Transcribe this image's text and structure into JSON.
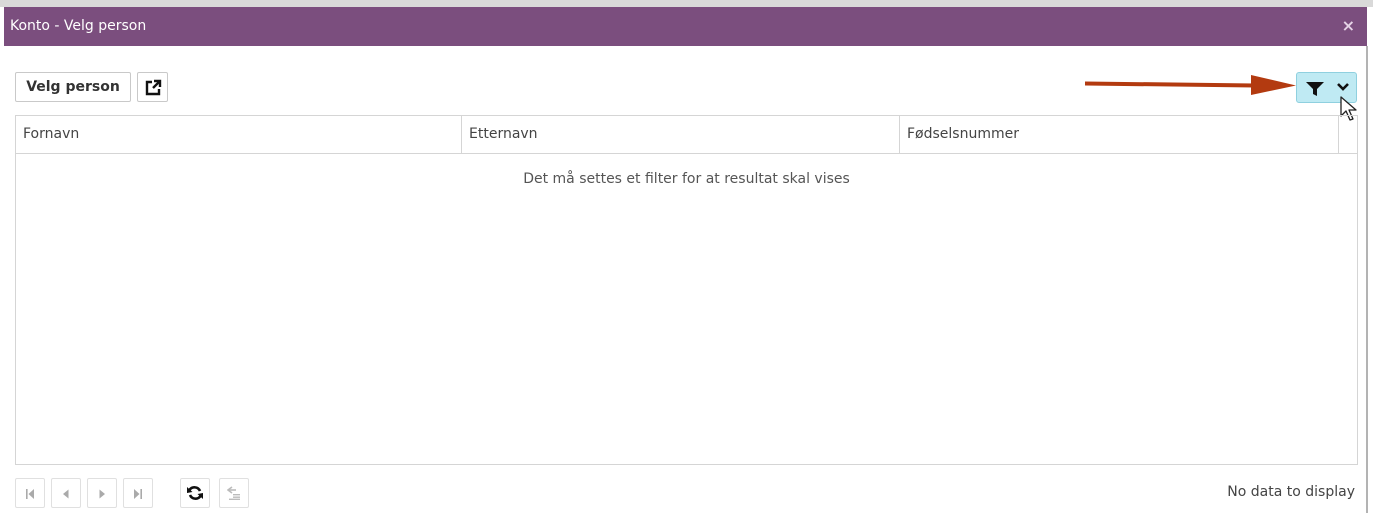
{
  "window": {
    "title": "Konto - Velg person",
    "close_label": "×"
  },
  "toolbar": {
    "velg_label": "Velg person"
  },
  "grid": {
    "columns": [
      "Fornavn",
      "Etternavn",
      "Fødselsnummer"
    ],
    "empty_message": "Det må settes et filter for at resultat skal vises"
  },
  "pager": {
    "status": "No data to display"
  },
  "colors": {
    "titlebar": "#7b4e7e",
    "filter_bg": "#bfeaf3",
    "annotation_arrow": "#b33a10"
  },
  "icons": [
    "external-link-icon",
    "funnel-icon",
    "chevron-down-icon",
    "first-page-icon",
    "prev-page-icon",
    "next-page-icon",
    "last-page-icon",
    "refresh-icon",
    "export-icon"
  ]
}
